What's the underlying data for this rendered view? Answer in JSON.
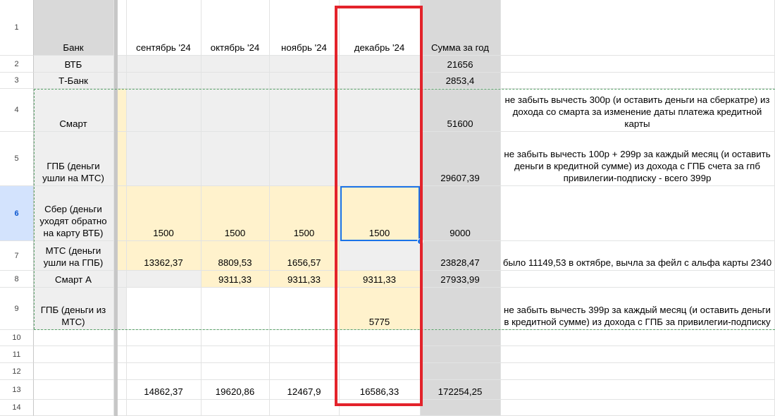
{
  "header_row": [
    "Банк",
    "сентябрь '24",
    "октябрь '24",
    "ноябрь '24",
    "декабрь '24",
    "Сумма за год"
  ],
  "row_numbers": [
    "1",
    "2",
    "3",
    "4",
    "5",
    "6",
    "7",
    "8",
    "9",
    "10",
    "11",
    "12",
    "13",
    "14"
  ],
  "rows": [
    {
      "bank": "ВТБ",
      "sep": "",
      "oct": "",
      "nov": "",
      "dec": "",
      "sum": "21656",
      "note": ""
    },
    {
      "bank": "Т-Банк",
      "sep": "",
      "oct": "",
      "nov": "",
      "dec": "",
      "sum": "2853,4",
      "note": ""
    },
    {
      "bank": "Смарт",
      "sep": "",
      "oct": "",
      "nov": "",
      "dec": "",
      "sum": "51600",
      "note": "не забыть вычесть 300р (и оставить деньги на сберкатре) из дохода со смарта за изменение даты платежа кредитной карты"
    },
    {
      "bank": "ГПБ (деньги ушли на МТС)",
      "sep": "",
      "oct": "",
      "nov": "",
      "dec": "",
      "sum": "29607,39",
      "note": "не забыть вычесть 100р + 299р за каждый месяц (и оставить деньги в кредитной сумме) из дохода с ГПБ счета за гпб привилегии-подписку - всего 399р"
    },
    {
      "bank": "Сбер (деньги уходят обратно на карту ВТБ)",
      "sep": "1500",
      "oct": "1500",
      "nov": "1500",
      "dec": "1500",
      "sum": "9000",
      "note": ""
    },
    {
      "bank": "МТС (деньги ушли на ГПБ)",
      "sep": "13362,37",
      "oct": "8809,53",
      "nov": "1656,57",
      "dec": "",
      "sum": "23828,47",
      "note": "было 11149,53 в октябре, вычла за фейл с альфа карты 2340"
    },
    {
      "bank": "Смарт А",
      "sep": "",
      "oct": "9311,33",
      "nov": "9311,33",
      "dec": "9311,33",
      "sum": "27933,99",
      "note": ""
    },
    {
      "bank": "ГПБ (деньги из МТС)",
      "sep": "",
      "oct": "",
      "nov": "",
      "dec": "5775",
      "sum": "",
      "note": "не забыть вычесть 399р за каждый месяц (и оставить деньги в кредитной сумме) из дохода с ГПБ за привилегии-подписку"
    }
  ],
  "totals": {
    "sep": "14862,37",
    "oct": "19620,86",
    "nov": "12467,9",
    "dec": "16586,33",
    "sum": "172254,25"
  },
  "colors": {
    "highlight_border": "#e3232b",
    "selection": "#1a73e8",
    "yellow_fill": "#fff2cc",
    "gray_fill": "#efefef",
    "sum_column_fill": "#d9d9d9"
  }
}
